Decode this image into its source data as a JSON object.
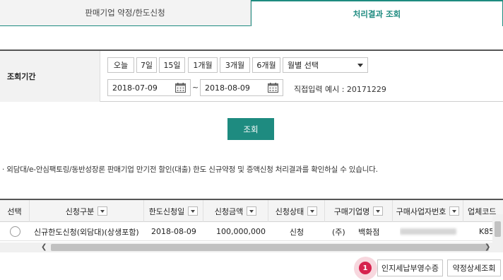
{
  "tabs": {
    "inactive_label": "판매기업 약정/한도신청",
    "active_label": "처리결과 조회"
  },
  "search": {
    "period_label": "조회기간",
    "period_buttons": [
      "오늘",
      "7일",
      "15일",
      "1개월",
      "3개월",
      "6개월"
    ],
    "month_select_value": "월별 선택",
    "start_date": "2018-07-09",
    "date_separator": "~",
    "end_date": "2018-08-09",
    "input_hint": "직접입력 예시 : 20171229",
    "search_button_label": "조회"
  },
  "notice": "· 외담대/e-안심팩토링/동반성장론 판매기업 만기전 할인(대출) 한도 신규약정 및 증액신청 처리결과를 확인하실 수 있습니다.",
  "grid": {
    "headers": {
      "select": "선택",
      "type": "신청구분",
      "date": "한도신청일",
      "amount": "신청금액",
      "status": "신청상태",
      "buyer": "구매기업명",
      "biz_no": "구매사업자번호",
      "code": "업체코드"
    },
    "rows": [
      {
        "type": "신규한도신청(외담대)(상생포함)",
        "date": "2018-08-09",
        "amount": "100,000,000",
        "status": "신청",
        "buyer_prefix": "(주)",
        "buyer_name": "백화점",
        "code": "K85"
      }
    ],
    "scroll_left_arrow": "❮",
    "scroll_right_arrow": "❯"
  },
  "actions": {
    "badge_number": "1",
    "stamp_tax_button": "인지세납부영수증",
    "contract_detail_button": "약정상세조회"
  },
  "colors": {
    "accent": "#1e8b80",
    "badge": "#d6224e"
  }
}
